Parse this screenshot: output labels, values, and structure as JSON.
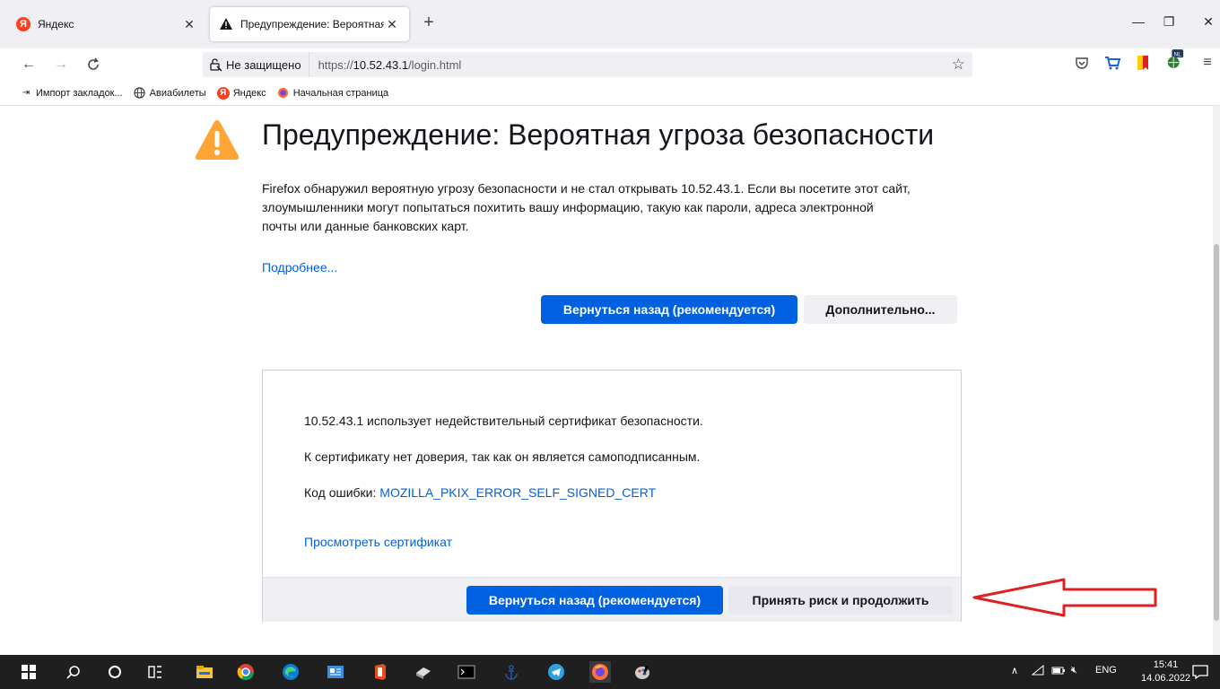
{
  "tabs": [
    {
      "label": "Яндекс",
      "icon": "yandex-icon",
      "favicon_letter": "Я"
    },
    {
      "label": "Предупреждение: Вероятная у",
      "icon": "warning-icon"
    }
  ],
  "window": {
    "minimize": "—",
    "maximize": "❐",
    "close": "✕"
  },
  "navbar": {
    "back": "←",
    "forward": "→",
    "reload": "C",
    "security_label": "Не защищено",
    "url_prefix": "https://",
    "url_host": "10.52.43.1",
    "url_path": "/login.html",
    "star": "☆"
  },
  "toolbar_icons": [
    "pocket-icon",
    "cart-icon",
    "bookmark-flag-icon",
    "extension-nl-icon",
    "menu-icon"
  ],
  "bookmarks": [
    {
      "label": "Импорт закладок...",
      "icon": "import-icon"
    },
    {
      "label": "Авиабилеты",
      "icon": "globe-icon"
    },
    {
      "label": "Яндекс",
      "icon": "yandex-icon"
    },
    {
      "label": "Начальная страница",
      "icon": "firefox-icon"
    }
  ],
  "page": {
    "title": "Предупреждение: Вероятная угроза безопасности",
    "description_lines": [
      "Firefox обнаружил вероятную угрозу безопасности и не стал открывать 10.52.43.1. Если вы посетите этот сайт,",
      "злоумышленники могут попытаться похитить вашу информацию, такую как пароли, адреса электронной",
      "почты или данные банковских карт."
    ],
    "more_link": "Подробнее...",
    "go_back_label": "Вернуться назад (рекомендуется)",
    "advanced_label": "Дополнительно...",
    "panel": {
      "line1": "10.52.43.1 использует недействительный сертификат безопасности.",
      "line2": "К сертификату нет доверия, так как он является самоподписанным.",
      "error_label": "Код ошибки: ",
      "error_code": "MOZILLA_PKIX_ERROR_SELF_SIGNED_CERT",
      "view_cert": "Просмотреть сертификат",
      "go_back_label": "Вернуться назад (рекомендуется)",
      "accept_label": "Принять риск и продолжить"
    }
  },
  "colors": {
    "accent": "#0061e0",
    "warning": "#ffa436",
    "arrow": "#e02020"
  },
  "taskbar": {
    "lang": "ENG",
    "time": "15:41",
    "date": "14.06.2022"
  }
}
